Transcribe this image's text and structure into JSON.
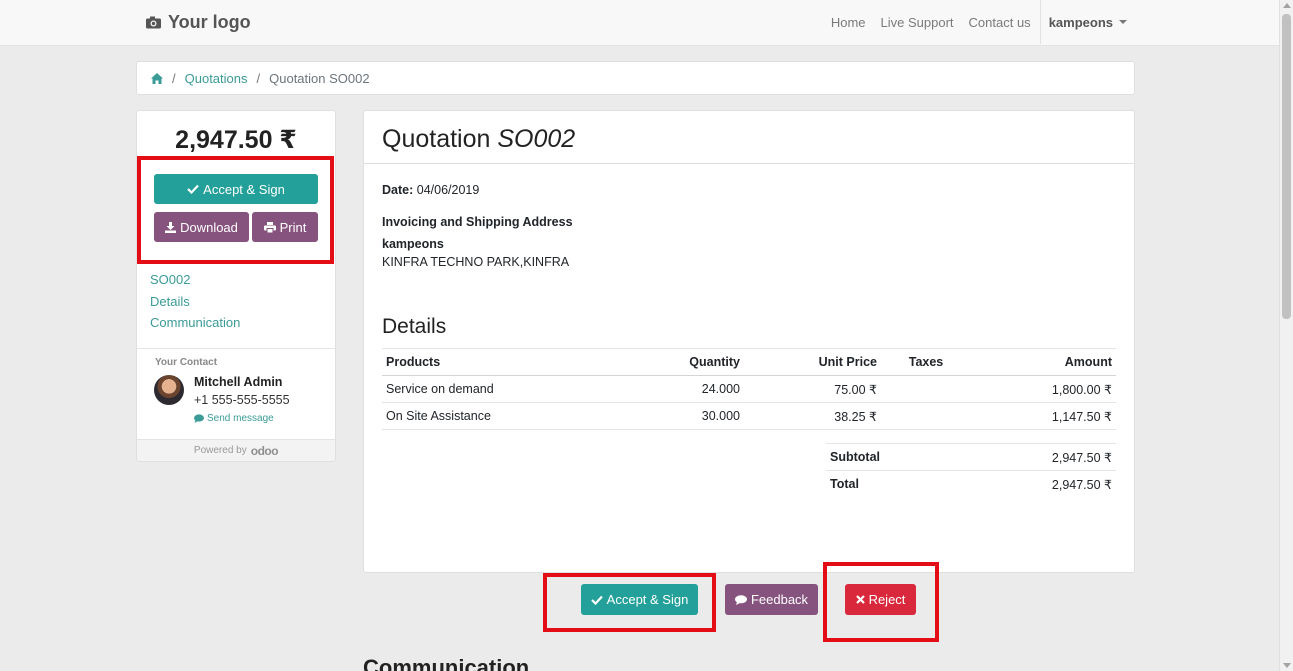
{
  "navbar": {
    "logo_text": "Your logo",
    "links": [
      "Home",
      "Live Support",
      "Contact us"
    ],
    "user": "kampeons"
  },
  "breadcrumb": {
    "link": "Quotations",
    "current": "Quotation SO002"
  },
  "sidebar": {
    "total": "2,947.50 ₹",
    "accept_label": "Accept & Sign",
    "download_label": "Download",
    "print_label": "Print",
    "nav": [
      "SO002",
      "Details",
      "Communication"
    ],
    "contact_label": "Your Contact",
    "contact_name": "Mitchell Admin",
    "contact_phone": "+1 555-555-5555",
    "send_message": "Send message",
    "powered_by": "Powered by",
    "powered_brand": "odoo"
  },
  "quote": {
    "title_prefix": "Quotation",
    "title_number": "SO002",
    "date_label": "Date:",
    "date_value": "04/06/2019",
    "address_label": "Invoicing and Shipping Address",
    "customer_name": "kampeons",
    "customer_address": "KINFRA TECHNO PARK,KINFRA",
    "details_heading": "Details",
    "columns": [
      "Products",
      "Quantity",
      "Unit Price",
      "Taxes",
      "Amount"
    ],
    "lines": [
      {
        "product": "Service on demand",
        "quantity": "24.000",
        "unit_price": "75.00 ₹",
        "taxes": "",
        "amount": "1,800.00 ₹"
      },
      {
        "product": "On Site Assistance",
        "quantity": "30.000",
        "unit_price": "38.25 ₹",
        "taxes": "",
        "amount": "1,147.50 ₹"
      }
    ],
    "subtotal_label": "Subtotal",
    "subtotal_value": "2,947.50 ₹",
    "total_label": "Total",
    "total_value": "2,947.50 ₹"
  },
  "actions": {
    "accept_label": "Accept & Sign",
    "feedback_label": "Feedback",
    "reject_label": "Reject"
  },
  "communication_heading": "Communication",
  "colors": {
    "teal": "#23a099",
    "purple": "#86537e",
    "red": "#d9283b",
    "link": "#3a9b97",
    "highlight": "#e30d15"
  }
}
